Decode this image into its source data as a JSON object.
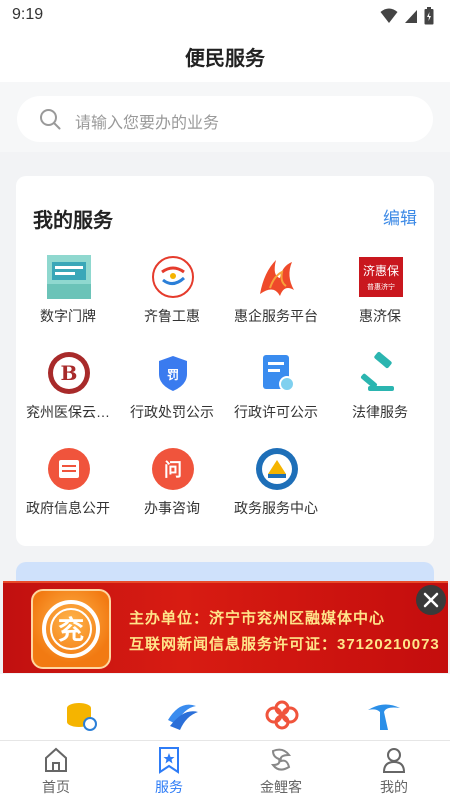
{
  "status": {
    "time": "9:19"
  },
  "header": {
    "title": "便民服务"
  },
  "search": {
    "placeholder": "请输入您要办的业务"
  },
  "my_services": {
    "title": "我的服务",
    "edit_label": "编辑",
    "items": [
      {
        "label": "数字门牌",
        "icon": "digital-doorplate-icon",
        "color": "#7fd0c4"
      },
      {
        "label": "齐鲁工惠",
        "icon": "qilu-gonghui-icon",
        "color": "#e53b2c"
      },
      {
        "label": "惠企服务平台",
        "icon": "huiqi-platform-icon",
        "color": "#e8452a"
      },
      {
        "label": "惠济保",
        "icon": "huijibao-icon",
        "color": "#c9171e"
      },
      {
        "label": "兖州医保云…",
        "icon": "yanzhou-medical-icon",
        "color": "#a82a2a"
      },
      {
        "label": "行政处罚公示",
        "icon": "penalty-shield-icon",
        "color": "#3a7bef"
      },
      {
        "label": "行政许可公示",
        "icon": "license-document-icon",
        "color": "#3a8cef"
      },
      {
        "label": "法律服务",
        "icon": "gavel-icon",
        "color": "#2bb5b0"
      },
      {
        "label": "政府信息公开",
        "icon": "gov-info-icon",
        "color": "#f0543c"
      },
      {
        "label": "办事咨询",
        "icon": "consult-icon",
        "color": "#f0543c"
      },
      {
        "label": "政务服务中心",
        "icon": "gov-center-emblem-icon",
        "color": "#1e6fb8"
      }
    ]
  },
  "banner": {
    "line1": "主办单位：济宁市兖州区融媒体中心",
    "line2": "互联网新闻信息服务许可证：37120210073",
    "logo_text": "兖"
  },
  "tabbar": {
    "items": [
      {
        "label": "首页",
        "icon": "home-icon",
        "active": false
      },
      {
        "label": "服务",
        "icon": "service-icon",
        "active": true
      },
      {
        "label": "金鲤客",
        "icon": "jinlike-icon",
        "active": false
      },
      {
        "label": "我的",
        "icon": "user-icon",
        "active": false
      }
    ]
  },
  "colors": {
    "accent": "#2e7cf6",
    "edit_link": "#3d8ae6",
    "banner_red": "#d81c12",
    "banner_text": "#ffe58a"
  }
}
